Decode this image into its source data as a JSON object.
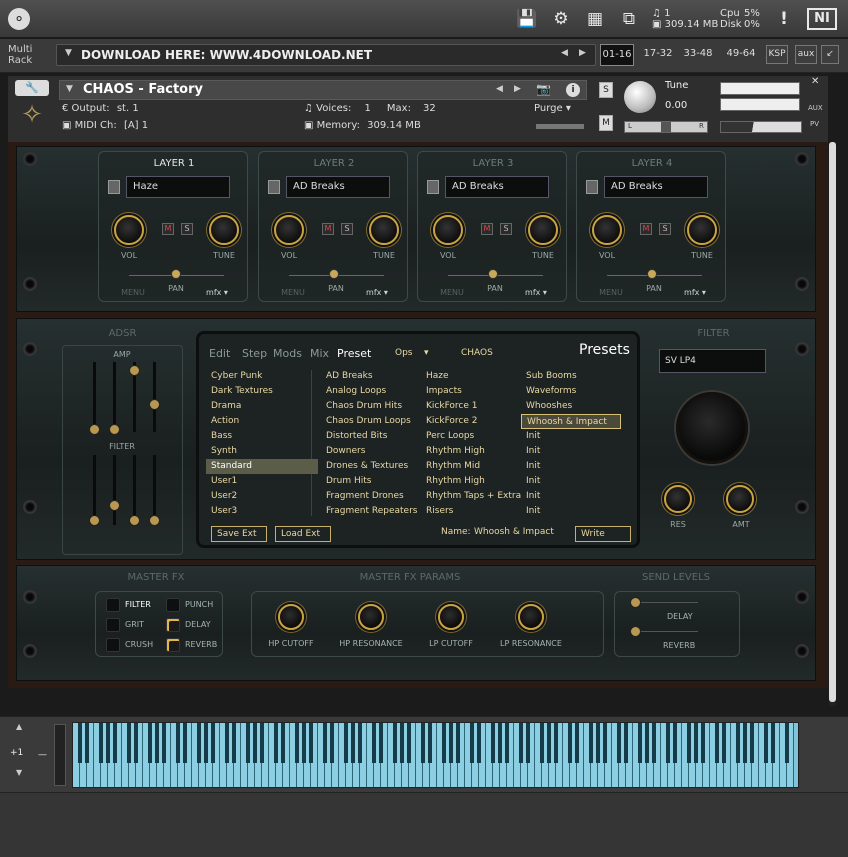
{
  "topbar": {
    "icons": [
      "logo-icon",
      "disk-icon",
      "gear-icon",
      "layout-icon",
      "resize-icon",
      "warning-icon",
      "ni-logo"
    ],
    "voices_count": "1",
    "memory_text": "309.14 MB",
    "cpu_label": "Cpu",
    "cpu_value": "5%",
    "disk_label": "Disk",
    "disk_value": "0%",
    "warning": "!",
    "ni_text": "NI"
  },
  "rack": {
    "label_line1": "Multi",
    "label_line2": "Rack",
    "download_text": "DOWNLOAD HERE: WWW.4DOWNLOAD.NET",
    "tabs": [
      "01-16",
      "17-32",
      "33-48",
      "49-64"
    ],
    "active_tab": "01-16",
    "ksp": "KSP",
    "aux": "aux"
  },
  "instrument": {
    "title": "CHAOS - Factory",
    "output_label": "Output:",
    "output_value": "st. 1",
    "voices_label": "Voices:",
    "voices_value": "1",
    "max_label": "Max:",
    "max_value": "32",
    "purge": "Purge",
    "midi_label": "MIDI Ch:",
    "midi_value": "[A]  1",
    "memory_label": "Memory:",
    "memory_value": "309.14 MB",
    "tune_label": "Tune",
    "tune_value": "0.00",
    "s": "S",
    "m": "M",
    "l": "L",
    "r": "R",
    "aux": "AUX",
    "pv": "PV",
    "info": "i"
  },
  "layers": [
    {
      "name": "LAYER 1",
      "preset": "Haze",
      "active": true
    },
    {
      "name": "LAYER 2",
      "preset": "AD Breaks",
      "active": false
    },
    {
      "name": "LAYER 3",
      "preset": "AD Breaks",
      "active": false
    },
    {
      "name": "LAYER 4",
      "preset": "AD Breaks",
      "active": false
    }
  ],
  "layer_labels": {
    "vol": "VOL",
    "tune": "TUNE",
    "pan": "PAN",
    "menu": "MENU",
    "mfx": "mfx",
    "m": "M",
    "s": "S"
  },
  "adsr": {
    "title": "ADSR",
    "amp": "AMP",
    "filter": "FILTER"
  },
  "browser": {
    "tabs": [
      "Edit",
      "Step",
      "Mods",
      "Mix",
      "Preset"
    ],
    "active_tab": "Preset",
    "ops": "Ops",
    "bank": "CHAOS",
    "header": "Presets",
    "col1": [
      "Cyber Punk",
      "Dark Textures",
      "Drama",
      "Action",
      "Bass",
      "Synth",
      "Standard",
      "User1",
      "User2",
      "User3"
    ],
    "col1_selected": 6,
    "col2": [
      "AD Breaks",
      "Analog Loops",
      "Chaos Drum Hits",
      "Chaos Drum Loops",
      "Distorted Bits",
      "Downers",
      "Drones & Textures",
      "Drum Hits",
      "Fragment Drones",
      "Fragment Repeaters"
    ],
    "col3": [
      "Haze",
      "Impacts",
      "KickForce 1",
      "KickForce 2",
      "Perc Loops",
      "Rhythm High",
      "Rhythm Mid",
      "Rhythm High",
      "Rhythm Taps + Extra",
      "Risers"
    ],
    "col4": [
      "Sub Booms",
      "Waveforms",
      "Whooshes",
      "Whoosh & Impact",
      "Init",
      "Init",
      "Init",
      "Init",
      "Init",
      "Init"
    ],
    "col4_highlight": 3,
    "save_ext": "Save Ext",
    "load_ext": "Load Ext",
    "name_label": "Name:",
    "name_value": "Whoosh & Impact",
    "write": "Write"
  },
  "filter": {
    "title": "FILTER",
    "type": "SV LP4",
    "res": "RES",
    "amt": "AMT"
  },
  "master_fx": {
    "title": "MASTER FX",
    "items": [
      {
        "label": "FILTER",
        "on": false,
        "bright": true
      },
      {
        "label": "PUNCH",
        "on": false,
        "bright": false
      },
      {
        "label": "GRIT",
        "on": false,
        "bright": false
      },
      {
        "label": "DELAY",
        "on": true,
        "bright": false
      },
      {
        "label": "CRUSH",
        "on": false,
        "bright": false
      },
      {
        "label": "REVERB",
        "on": true,
        "bright": false
      }
    ]
  },
  "master_params": {
    "title": "MASTER FX PARAMS",
    "knobs": [
      "HP CUTOFF",
      "HP RESONANCE",
      "LP CUTOFF",
      "LP RESONANCE"
    ]
  },
  "send_levels": {
    "title": "SEND LEVELS",
    "delay": "DELAY",
    "reverb": "REVERB"
  },
  "keyboard": {
    "octave": "+1",
    "minus": "—"
  },
  "colors": {
    "accent": "#c9a440",
    "preset_text": "#e8d9a4",
    "keys": "#8ccfe3"
  }
}
